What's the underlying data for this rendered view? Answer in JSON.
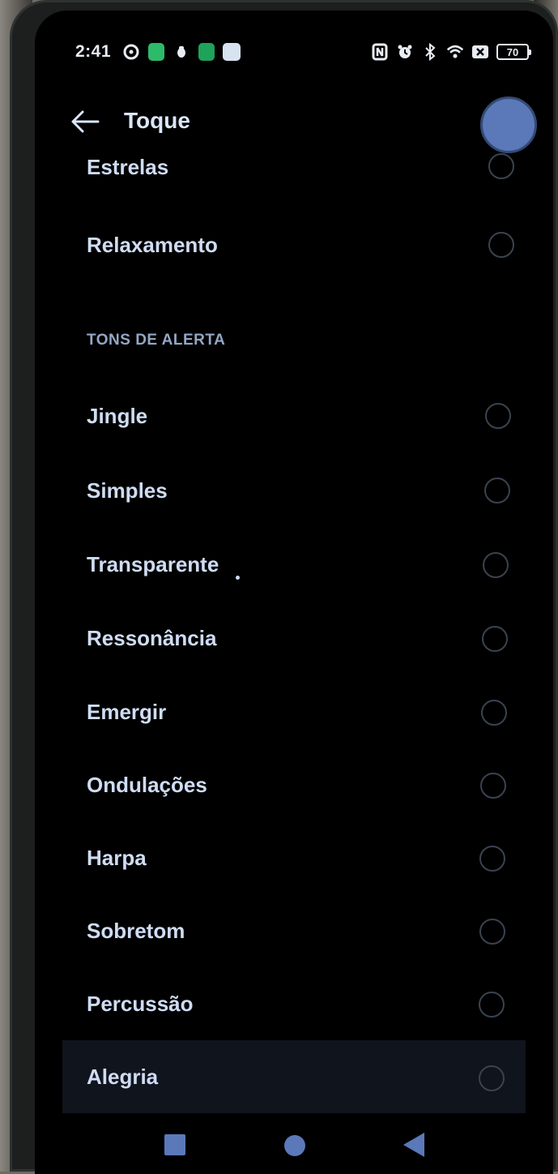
{
  "status_bar": {
    "time": "2:41",
    "battery": "70",
    "icons_left": [
      "settings-icon",
      "grid-app-icon",
      "bug-icon",
      "app-icon",
      "message-icon"
    ],
    "icons_right": [
      "nfc-icon",
      "alarm-icon",
      "bluetooth-icon",
      "wifi-icon",
      "sim-off-icon",
      "battery-icon"
    ]
  },
  "header": {
    "title": "Toque",
    "back_icon": "arrow-left-icon"
  },
  "ringtones": [
    {
      "label": "Estrelas"
    },
    {
      "label": "Relaxamento"
    }
  ],
  "alert_section": {
    "title": "TONS DE ALERTA",
    "items": [
      {
        "label": "Jingle"
      },
      {
        "label": "Simples"
      },
      {
        "label": "Transparente"
      },
      {
        "label": "Ressonância"
      },
      {
        "label": "Emergir"
      },
      {
        "label": "Ondulações"
      },
      {
        "label": "Harpa"
      },
      {
        "label": "Sobretom"
      },
      {
        "label": "Percussão"
      },
      {
        "label": "Alegria"
      }
    ]
  },
  "colors": {
    "accent": "#5b79b8",
    "text": "#cfdcf3",
    "background": "#000000"
  }
}
